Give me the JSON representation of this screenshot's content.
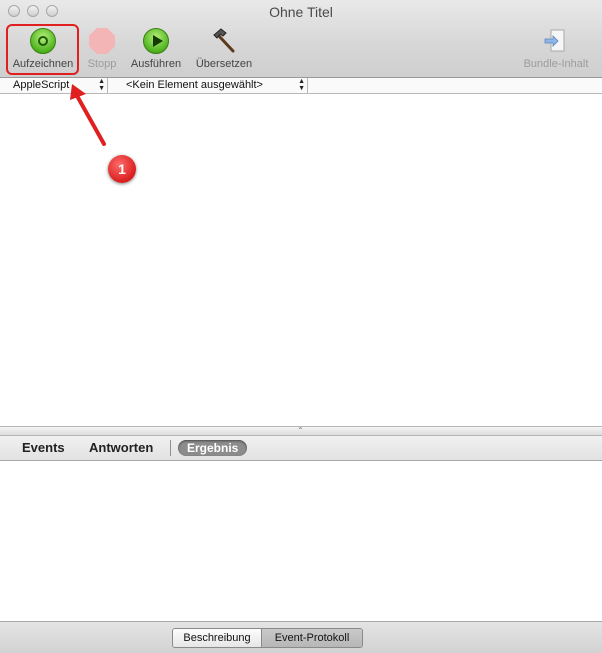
{
  "window": {
    "title": "Ohne Titel"
  },
  "toolbar": {
    "record_label": "Aufzeichnen",
    "stop_label": "Stopp",
    "run_label": "Ausführen",
    "compile_label": "Übersetzen",
    "bundle_label": "Bundle-Inhalt"
  },
  "navbar": {
    "language": "AppleScript",
    "element": "<Kein Element ausgewählt>"
  },
  "result_tabs": {
    "events": "Events",
    "replies": "Antworten",
    "result": "Ergebnis",
    "selected": "Ergebnis"
  },
  "bottom_segments": {
    "description": "Beschreibung",
    "event_log": "Event-Protokoll",
    "selected": "Event-Protokoll"
  },
  "annotation": {
    "badge": "1",
    "color": "#e02020"
  },
  "colors": {
    "accent_green": "#4fb31e",
    "highlight_red": "#e02020"
  }
}
